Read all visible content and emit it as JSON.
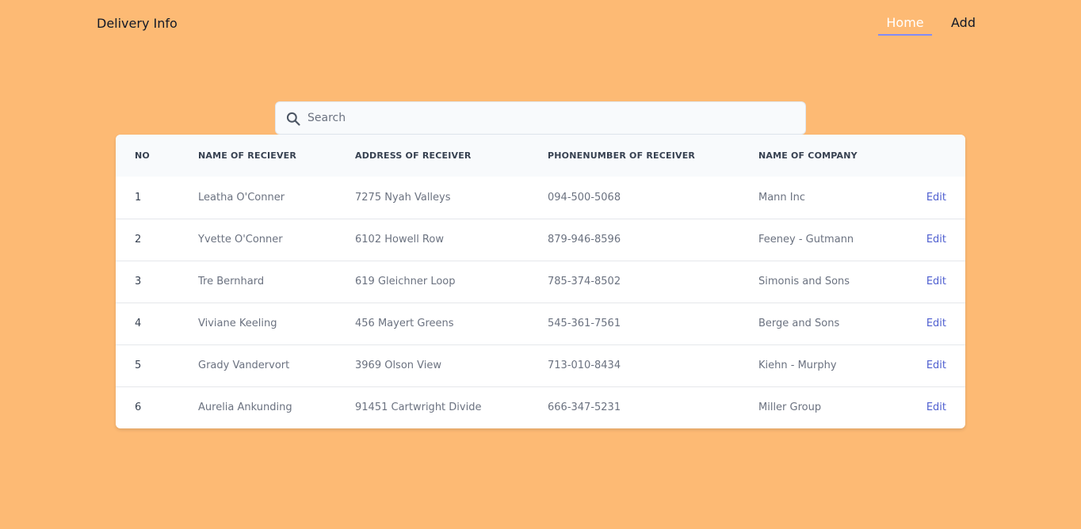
{
  "nav": {
    "brand": "Delivery Info",
    "home_label": "Home",
    "add_label": "Add"
  },
  "search": {
    "placeholder": "Search",
    "value": ""
  },
  "table": {
    "headers": [
      "NO",
      "NAME OF RECIEVER",
      "ADDRESS OF RECEIVER",
      "PHONENUMBER OF RECEIVER",
      "NAME OF COMPANY",
      ""
    ],
    "rows": [
      {
        "no": "1",
        "name": "Leatha O'Conner",
        "address": "7275 Nyah Valleys",
        "phone": "094-500-5068",
        "company": "Mann Inc",
        "action": "Edit"
      },
      {
        "no": "2",
        "name": "Yvette O'Conner",
        "address": "6102 Howell Row",
        "phone": "879-946-8596",
        "company": "Feeney - Gutmann",
        "action": "Edit"
      },
      {
        "no": "3",
        "name": "Tre Bernhard",
        "address": "619 Gleichner Loop",
        "phone": "785-374-8502",
        "company": "Simonis and Sons",
        "action": "Edit"
      },
      {
        "no": "4",
        "name": "Viviane Keeling",
        "address": "456 Mayert Greens",
        "phone": "545-361-7561",
        "company": "Berge and Sons",
        "action": "Edit"
      },
      {
        "no": "5",
        "name": "Grady Vandervort",
        "address": "3969 Olson View",
        "phone": "713-010-8434",
        "company": "Kiehn - Murphy",
        "action": "Edit"
      },
      {
        "no": "6",
        "name": "Aurelia Ankunding",
        "address": "91451 Cartwright Divide",
        "phone": "666-347-5231",
        "company": "Miller Group",
        "action": "Edit"
      }
    ]
  },
  "colors": {
    "background": "#fdba74",
    "nav_underline": "#818cf8",
    "link": "#4f5fd0"
  },
  "icons": {
    "search": "search-icon"
  }
}
